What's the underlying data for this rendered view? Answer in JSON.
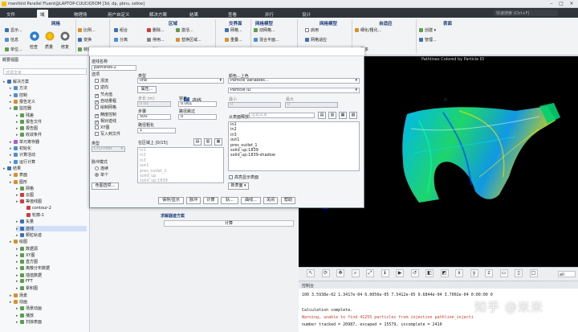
{
  "window": {
    "title": "manifold Parallel Fluent@LAPTOP-CUUCIQ5OM  [3d, dp, pbns, sstkw]",
    "search_placeholder": "快速搜索 (Ctrl+F)"
  },
  "ribbon": {
    "tabs": [
      "文件",
      "域",
      "物理场",
      "用户自定义",
      "解决方案",
      "结果",
      "查看",
      "并行",
      "设计"
    ],
    "active_tab": "域",
    "groups": [
      {
        "title": "网格",
        "items": [
          "显示...",
          "信息",
          "单位..."
        ]
      },
      {
        "title": "",
        "items": [
          "检查",
          "质量",
          "修复"
        ]
      },
      {
        "title": "",
        "items": [
          "比例...",
          "变换",
          "转换"
        ]
      },
      {
        "title": "区域",
        "items": [
          "组合",
          "分离",
          "删除...",
          "停用...",
          "激活...",
          "替换区域...",
          "附加"
        ]
      },
      {
        "title": "交界面",
        "items": [
          "网格...",
          "重叠..."
        ]
      },
      {
        "title": "网格模型",
        "items": [
          "动网格...",
          "混合平面..."
        ]
      },
      {
        "title": "网格模型",
        "items": [
          "启用",
          "网格适应",
          "更多"
        ]
      },
      {
        "title": "自适应",
        "items": [
          "细化/粗化...",
          "更多"
        ]
      },
      {
        "title": "表面",
        "items": [
          "创建",
          "管理..."
        ]
      }
    ]
  },
  "tree": {
    "header": "概要视图",
    "filter_placeholder": "过滤文本",
    "items": [
      {
        "label": "解决方案",
        "level": 0,
        "icon_color": "#3f6fb5"
      },
      {
        "label": "方法",
        "level": 1,
        "icon_color": "#4a8fd8"
      },
      {
        "label": "控制",
        "level": 1,
        "icon_color": "#4a8fd8"
      },
      {
        "label": "报告定义",
        "level": 1,
        "icon_color": "#d9902b"
      },
      {
        "label": "监控器",
        "level": 1,
        "icon_color": "#5b9e4d"
      },
      {
        "label": "残差",
        "level": 2,
        "icon_color": "#5b9e4d"
      },
      {
        "label": "报告文件",
        "level": 2,
        "icon_color": "#5b9e4d"
      },
      {
        "label": "报告图",
        "level": 2,
        "icon_color": "#5b9e4d"
      },
      {
        "label": "收敛条件",
        "level": 2,
        "icon_color": "#5b9e4d"
      },
      {
        "label": "单元寄存器",
        "level": 1,
        "icon_color": "#b05ad1"
      },
      {
        "label": "初始化",
        "level": 1,
        "icon_color": "#4a8fd8"
      },
      {
        "label": "计算活动",
        "level": 1,
        "icon_color": "#4a8fd8"
      },
      {
        "label": "运行计算",
        "level": 1,
        "icon_color": "#4a8fd8"
      },
      {
        "label": "结果",
        "level": 0,
        "icon_color": "#3f6fb5"
      },
      {
        "label": "表面",
        "level": 1,
        "icon_color": "#d9902b"
      },
      {
        "label": "图形",
        "level": 1,
        "icon_color": "#d9902b"
      },
      {
        "label": "网格",
        "level": 2,
        "icon_color": "#5b9e4d"
      },
      {
        "label": "云图",
        "level": 2,
        "icon_color": "#d13b3b"
      },
      {
        "label": "等值线图",
        "level": 2,
        "icon_color": "#d13b3b"
      },
      {
        "label": "contour-2",
        "level": 3,
        "icon_color": "#d13b3b"
      },
      {
        "label": "轮廓-1",
        "level": 3,
        "icon_color": "#d13b3b"
      },
      {
        "label": "矢量",
        "level": 2,
        "icon_color": "#3f6fb5"
      },
      {
        "label": "迹线",
        "level": 2,
        "icon_color": "#3f6fb5",
        "selected": true
      },
      {
        "label": "颗粒轨迹",
        "level": 2,
        "icon_color": "#3f6fb5"
      },
      {
        "label": "绘图",
        "level": 1,
        "icon_color": "#d9902b"
      },
      {
        "label": "数据源",
        "level": 2,
        "icon_color": "#5b9e4d"
      },
      {
        "label": "XY图",
        "level": 2,
        "icon_color": "#5b9e4d"
      },
      {
        "label": "直方图",
        "level": 2,
        "icon_color": "#5b9e4d"
      },
      {
        "label": "离散分布数据",
        "level": 2,
        "icon_color": "#5b9e4d"
      },
      {
        "label": "插值数据",
        "level": 2,
        "icon_color": "#5b9e4d"
      },
      {
        "label": "FFT",
        "level": 2,
        "icon_color": "#5b9e4d"
      },
      {
        "label": "累积图",
        "level": 2,
        "icon_color": "#5b9e4d"
      },
      {
        "label": "场景",
        "level": 1,
        "icon_color": "#d9902b"
      },
      {
        "label": "动画",
        "level": 1,
        "icon_color": "#d9902b"
      },
      {
        "label": "场景动画",
        "level": 2,
        "icon_color": "#5b9e4d"
      },
      {
        "label": "播放",
        "level": 2,
        "icon_color": "#5b9e4d"
      },
      {
        "label": "扫掠表面",
        "level": 2,
        "icon_color": "#5b9e4d"
      }
    ]
  },
  "dialog": {
    "title": "迹线",
    "name_label": "迹线名称",
    "name_value": "pathlines-2",
    "options_label": "选项",
    "options": [
      {
        "label": "漂流",
        "checked": false
      },
      {
        "label": "逆向",
        "checked": false
      },
      {
        "label": "节点值",
        "checked": true
      },
      {
        "label": "自动量程",
        "checked": true
      },
      {
        "label": "绘制网格",
        "checked": false
      },
      {
        "label": "精度控制",
        "checked": true
      },
      {
        "label": "相对迹线",
        "checked": true
      },
      {
        "label": "XY图",
        "checked": false
      },
      {
        "label": "写入到文件",
        "checked": false
      }
    ],
    "type_label": "类型",
    "type_value": "CFD-Post",
    "release_label": "脉冲模式",
    "release_options": [
      {
        "label": "连续",
        "on": false
      },
      {
        "label": "单个",
        "on": true
      }
    ],
    "colormap_btn": "色图选项...",
    "style_label": "类型",
    "style_value": "line",
    "attr_btn": "属性...",
    "step_label": "步长 (m)",
    "step_value": "0.01",
    "tolerance_label": "容差",
    "tolerance_value": "0.001",
    "steps_label": "步骤",
    "steps_value": "500",
    "path_skip_label": "路径跳过",
    "path_skip_value": "0",
    "coarsen_label": "路径粗化",
    "coarsen_value": "1",
    "on_zone_label": "在区域上 [0/15]",
    "on_zone_items": [
      "in1",
      "in2",
      "in3",
      "out1",
      "pres_outlet_1",
      "solid_up",
      "solid_up:1839"
    ],
    "color_label": "颜色...上色",
    "color_cat": "Particle Variables...",
    "color_var": "Particle ID",
    "min_label": "最小",
    "min_value": "0",
    "max_label": "最大",
    "max_value": "0",
    "release_from_label": "从表面释放",
    "release_filter_placeholder": "过滤文本",
    "surface_items": [
      "in1",
      "in2",
      "in3",
      "out1",
      "pres_outlet_1",
      "solid_up:1839",
      "solid_up:1839-shadow"
    ],
    "highlight_label": "高亮显示表面",
    "new_surface_btn": "新表面",
    "buttons": [
      "保存/显示",
      "脉冲",
      "计算",
      "轨...",
      "曲线...",
      "关闭",
      "帮助"
    ]
  },
  "task": {
    "title": "求解器迹方案",
    "compute_label": "计算"
  },
  "graphics": {
    "title": "Pathlines Colored by Particle ID",
    "toolbar": [
      "select-icon",
      "rotate-icon",
      "pan-icon",
      "zoom-icon",
      "fit-icon",
      "info-icon",
      "play-icon",
      "reset-icon",
      "view-icon",
      "iso-icon",
      "x-axis-icon",
      "y-axis-icon",
      "z-axis-icon",
      "xz-icon",
      "yz-icon",
      "xy-icon"
    ],
    "zoom_value": "all"
  },
  "console": {
    "header": "控制台",
    "lines": [
      {
        "text": "  100  3.5938e-02  1.3417e-04  6.0056e-05  7.5412e-05  9.6844e-04  3.7002e-04  0:00:00     0",
        "warn": false
      },
      {
        "text": "",
        "warn": false
      },
      {
        "text": "Calculation complete.",
        "warn": false
      },
      {
        "text": "Warning, unable to find 41255 particles from injection pathline_injecti",
        "warn": true
      },
      {
        "text": "number tracked = 20987, escaped = 15579, incomplete = 2410",
        "warn": false
      }
    ],
    "watermark": "知乎 @米米"
  },
  "colors": {
    "accent": "#1a3e7a",
    "tab_bar": "#2f353b",
    "selected": "#cfe0f7",
    "warning": "#d23a2e"
  }
}
